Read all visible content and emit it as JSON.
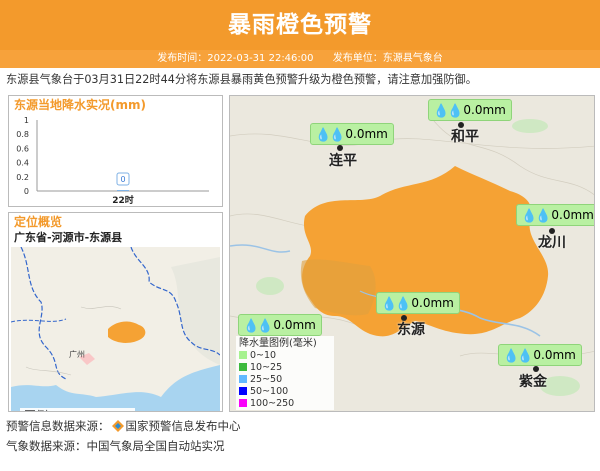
{
  "header": {
    "title": "暴雨橙色预警"
  },
  "meta": {
    "publish_time": "发布时间：2022-03-31 22:46:00",
    "publisher": "发布单位：东源县气象台"
  },
  "description": "东源县气象台于03月31日22时44分将东源县暴雨黄色预警升级为橙色预警，请注意加强防御。",
  "rain_panel": {
    "title": "东源当地降水实况(mm)",
    "chart_data": {
      "type": "bar",
      "categories": [
        "22时"
      ],
      "values": [
        0
      ],
      "data_labels": [
        "0"
      ],
      "ylim": [
        0,
        1
      ],
      "yticks": [
        "0",
        "0.2",
        "0.4",
        "0.6",
        "0.8",
        "1"
      ],
      "title": "东源当地降水实况(mm)"
    }
  },
  "location_panel": {
    "title": "定位概览",
    "path": "广东省-河源市-东源县",
    "minimap_labels": [
      "广州"
    ],
    "legend": {
      "title": "图例",
      "country": "国界",
      "province": "省界"
    }
  },
  "map": {
    "stations": [
      {
        "name": "连平",
        "value": "0.0mm"
      },
      {
        "name": "和平",
        "value": "0.0mm"
      },
      {
        "name": "龙川",
        "value": "0.0mm"
      },
      {
        "name": "东源",
        "value": "0.0mm"
      },
      {
        "name": "紫金",
        "value": "0.0mm"
      }
    ],
    "extra_station_value": "0.0mm",
    "legend": {
      "title": "降水量图例(毫米)",
      "items": [
        {
          "label": "0~10",
          "color": "#a6f28f"
        },
        {
          "label": "10~25",
          "color": "#3dba3d"
        },
        {
          "label": "25~50",
          "color": "#61b8ff"
        },
        {
          "label": "50~100",
          "color": "#0000ff"
        },
        {
          "label": "100~250",
          "color": "#fa00fa"
        }
      ]
    },
    "warning_color": "#f5a234"
  },
  "footer": {
    "warn_source": "预警信息数据来源：",
    "warn_source_name": "国家预警信息发布中心",
    "weather_source": "气象数据来源：中国气象局全国自动站实况"
  },
  "colors": {
    "accent": "#f39a2c",
    "country_line": "#cc6666",
    "province_line": "#3366cc"
  }
}
